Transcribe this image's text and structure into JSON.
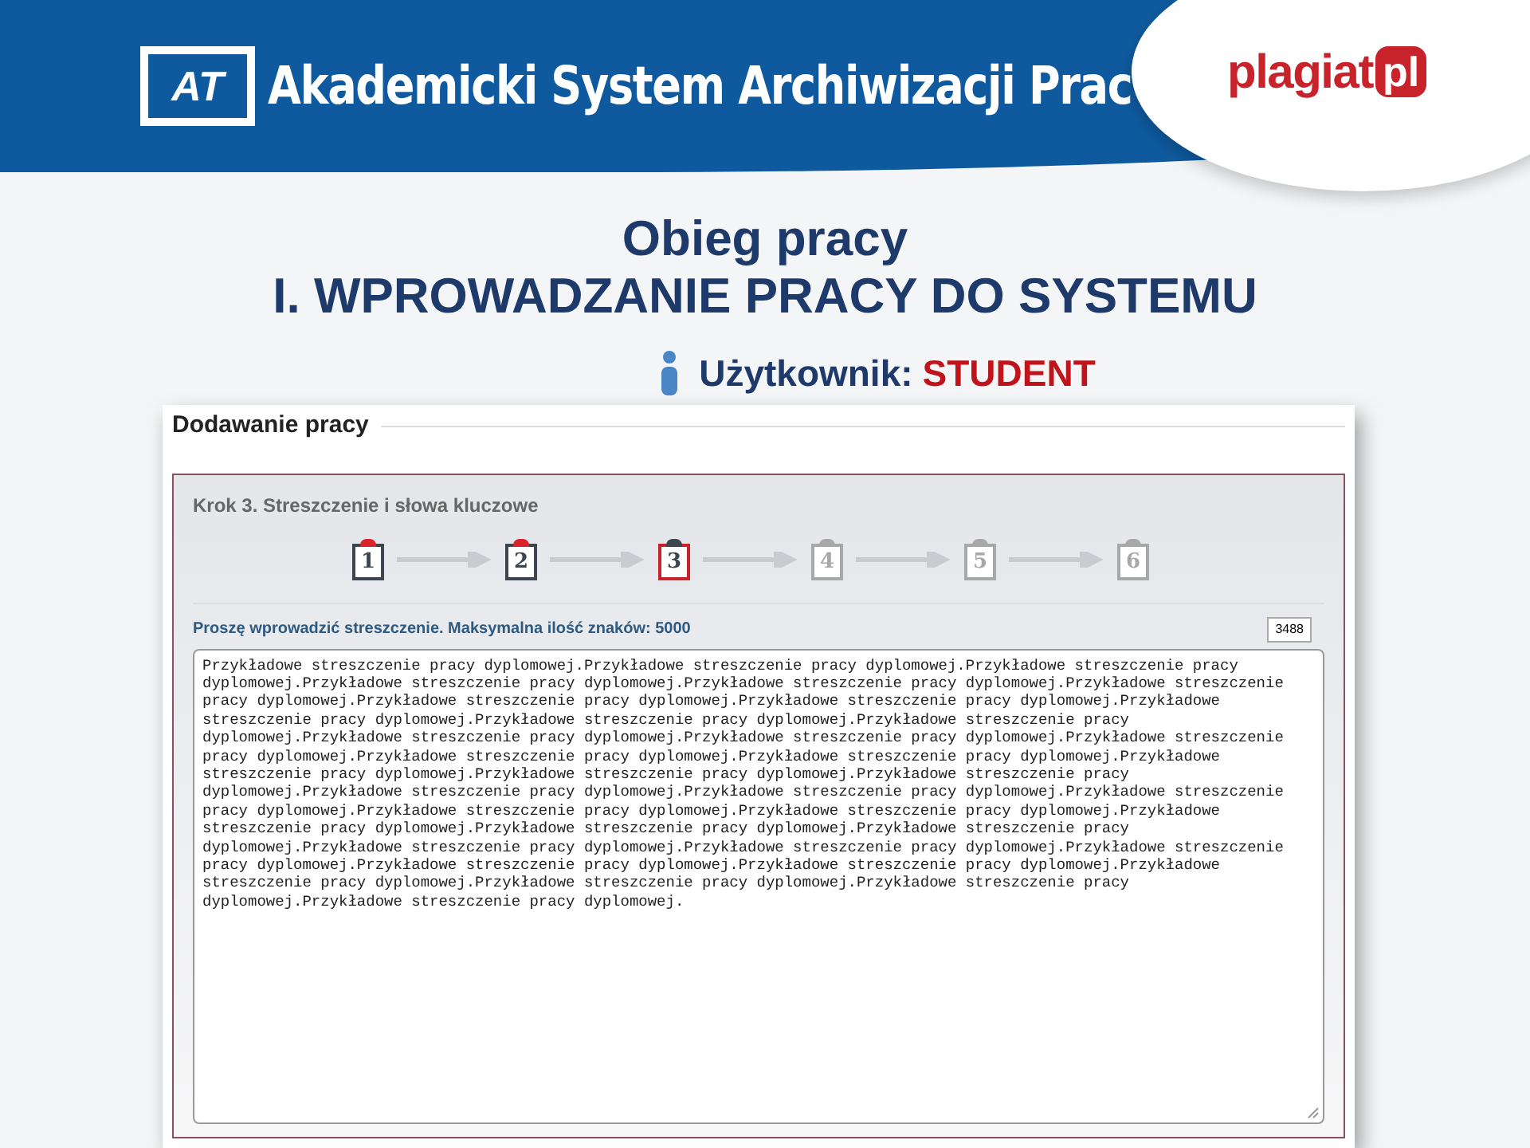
{
  "banner": {
    "title": "Akademicki System Archiwizacji Prac",
    "logo_mark": "AT",
    "partner_logo": {
      "part_1": "plagiat",
      "part_2": "pl"
    }
  },
  "slide": {
    "title": "Obieg pracy",
    "subtitle": "I. WPROWADZANIE PRACY DO SYSTEMU",
    "user_label": "Użytkownik:",
    "user_role": "STUDENT"
  },
  "panel": {
    "title": "Dodawanie pracy",
    "step_title": "Krok 3. Streszczenie i słowa kluczowe",
    "steps": [
      {
        "label": "1",
        "completed": true,
        "selected": false
      },
      {
        "label": "2",
        "completed": true,
        "selected": false
      },
      {
        "label": "3",
        "completed": false,
        "selected": true
      },
      {
        "label": "4",
        "completed": false,
        "selected": false
      },
      {
        "label": "5",
        "completed": false,
        "selected": false
      },
      {
        "label": "6",
        "completed": false,
        "selected": false
      }
    ],
    "prompt": "Proszę wprowadzić streszczenie. Maksymalna ilość znaków: 5000",
    "counter": "3488",
    "abstract": "Przykładowe streszczenie pracy dyplomowej.Przykładowe streszczenie pracy dyplomowej.Przykładowe streszczenie pracy dyplomowej.Przykładowe streszczenie pracy dyplomowej.Przykładowe streszczenie pracy dyplomowej.Przykładowe streszczenie pracy dyplomowej.Przykładowe streszczenie pracy dyplomowej.Przykładowe streszczenie pracy dyplomowej.Przykładowe streszczenie pracy dyplomowej.Przykładowe streszczenie pracy dyplomowej.Przykładowe streszczenie pracy dyplomowej.Przykładowe streszczenie pracy dyplomowej.Przykładowe streszczenie pracy dyplomowej.Przykładowe streszczenie pracy dyplomowej.Przykładowe streszczenie pracy dyplomowej.Przykładowe streszczenie pracy dyplomowej.Przykładowe streszczenie pracy dyplomowej.Przykładowe streszczenie pracy dyplomowej.Przykładowe streszczenie pracy dyplomowej.Przykładowe streszczenie pracy dyplomowej.Przykładowe streszczenie pracy dyplomowej.Przykładowe streszczenie pracy dyplomowej.Przykładowe streszczenie pracy dyplomowej.Przykładowe streszczenie pracy dyplomowej.Przykładowe streszczenie pracy dyplomowej.Przykładowe streszczenie pracy dyplomowej.Przykładowe streszczenie pracy dyplomowej.Przykładowe streszczenie pracy dyplomowej.Przykładowe streszczenie pracy dyplomowej.Przykładowe streszczenie pracy dyplomowej.Przykładowe streszczenie pracy dyplomowej.Przykładowe streszczenie pracy dyplomowej.Przykładowe streszczenie pracy dyplomowej.Przykładowe streszczenie pracy dyplomowej.Przykładowe streszczenie pracy dyplomowej.Przykładowe streszczenie pracy dyplomowej."
  }
}
